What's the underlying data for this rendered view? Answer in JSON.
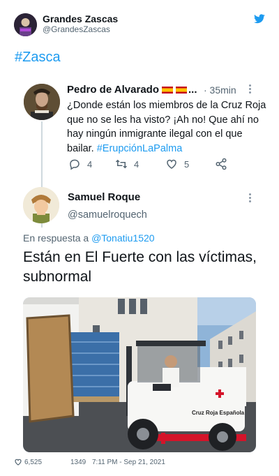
{
  "account": {
    "name": "Grandes Zascas",
    "handle": "@GrandesZascas",
    "avatar_text": "VISTO EN LAS REDES"
  },
  "hashtag": "#Zasca",
  "quoted_tweet": {
    "name": "Pedro de Alvarado",
    "truncation": "...",
    "time": "· 35min",
    "text": "¿Donde están los miembros de la Cruz Roja que no se les ha visto? ¡Ah no! Que ahí no hay ningún inmigrante ilegal con el que bailar.",
    "hashtag": "#ErupciónLaPalma",
    "replies": "4",
    "retweets": "4",
    "likes": "5"
  },
  "reply": {
    "name": "Samuel Roque",
    "handle": "@samuelroquech",
    "in_reply_label": "En respuesta a",
    "in_reply_handle": "@Tonatiu1520",
    "text": "Están en El Fuerte con las víctimas, subnormal",
    "photo_text": "Cruz Roja Española",
    "likes": "6,525",
    "count": "1349",
    "timestamp": "7:11 PM - Sep 21, 2021"
  },
  "colors": {
    "accent": "#1d9bf0",
    "muted": "#536471",
    "red_cross": "#d4142a"
  },
  "icons": [
    "twitter-bird-icon",
    "reply-icon",
    "retweet-icon",
    "heart-icon",
    "share-icon",
    "more-icon"
  ]
}
